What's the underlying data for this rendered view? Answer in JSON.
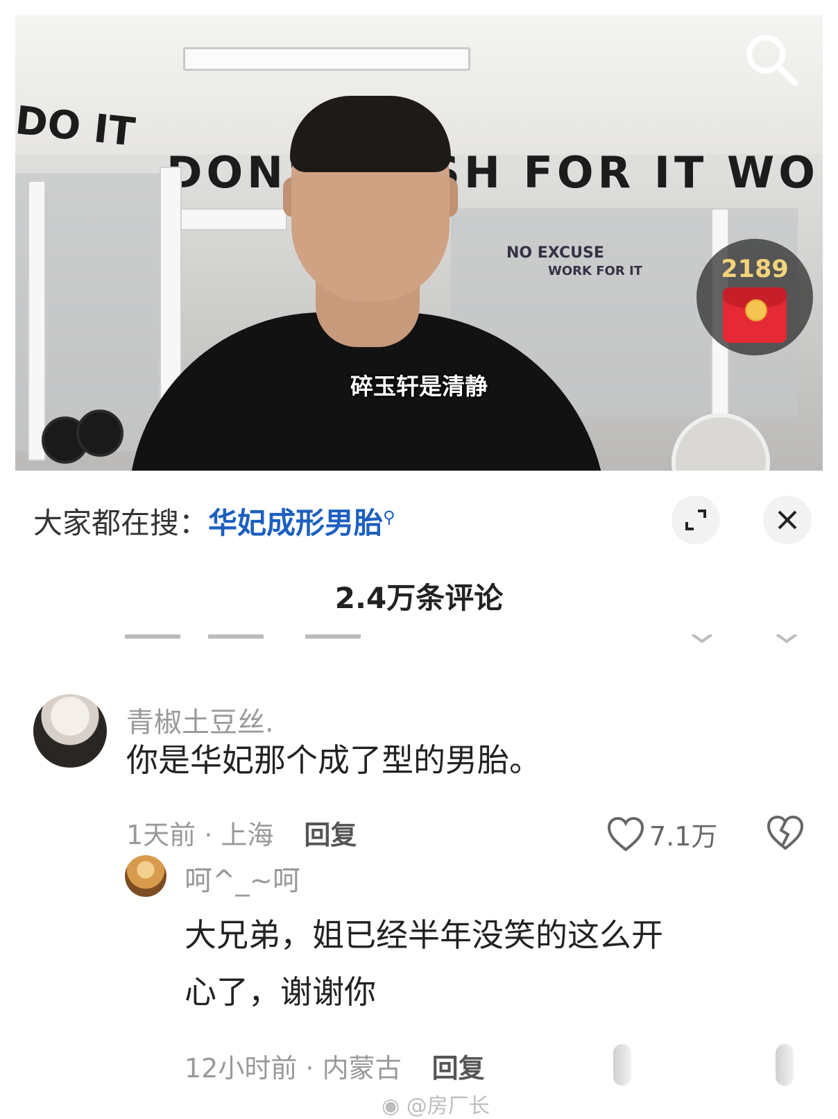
{
  "video": {
    "wall_slogan": "DON'T WISH FOR IT WO",
    "wall_slogan_left": "DO IT",
    "mirror_sign_1": "NO EXCUSE",
    "mirror_sign_2": "WORK FOR IT",
    "subtitle": "碎玉轩是清静",
    "red_packet_count": "2189"
  },
  "panel": {
    "hot_search_label": "大家都在搜：",
    "hot_search_keyword": "华妃成形男胎",
    "comment_count_label": "2.4万条评论"
  },
  "comments": [
    {
      "username": "青椒土豆丝.",
      "text": "你是华妃那个成了型的男胎。",
      "time_location": "1天前 · 上海",
      "reply_label": "回复",
      "like_count": "7.1万"
    },
    {
      "username": "呵^_~呵",
      "text_line1": "大兄弟，姐已经半年没笑的这么开",
      "text_line2": "心了，谢谢你",
      "time_location": "12小时前 · 内蒙古",
      "reply_label": "回复"
    }
  ],
  "watermark": "@房厂长",
  "colors": {
    "keyword_blue": "#1c5fbf",
    "red_packet": "#e52935",
    "count_gold": "#f3d37b"
  },
  "icons": [
    "search-icon",
    "red-packet-icon",
    "expand-icon",
    "close-icon",
    "heart-icon",
    "broken-heart-icon",
    "weibo-logo-icon"
  ]
}
